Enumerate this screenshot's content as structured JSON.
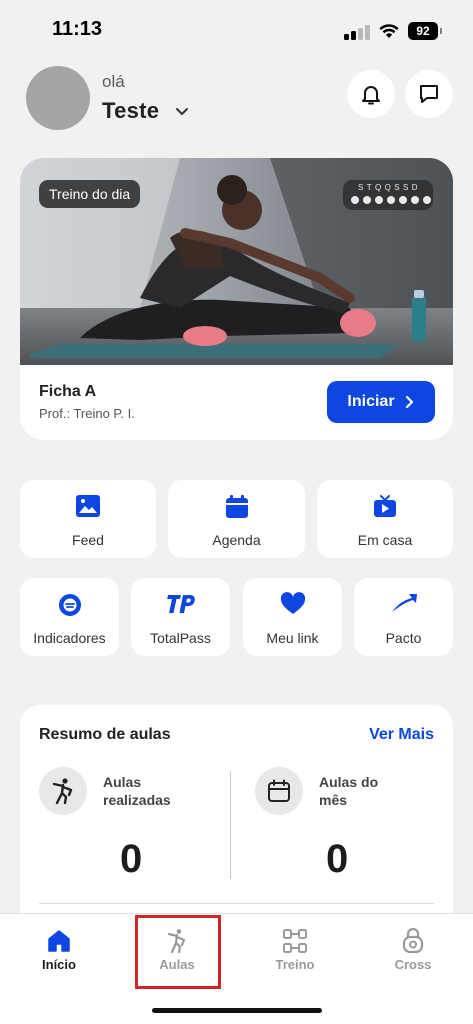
{
  "status_bar": {
    "time": "11:13",
    "battery": "92"
  },
  "header": {
    "greeting": "olá",
    "user_name": "Teste",
    "icons": [
      "bell-icon",
      "chat-icon",
      "chevron-down-icon"
    ]
  },
  "workout_card": {
    "badge": "Treino do dia",
    "week_days": "STQQSSD",
    "sheet_name": "Ficha A",
    "instructor": "Prof.: Treino P. I.",
    "start_label": "Iniciar"
  },
  "shortcuts_row1": [
    {
      "label": "Feed",
      "icon": "image-icon"
    },
    {
      "label": "Agenda",
      "icon": "calendar-icon"
    },
    {
      "label": "Em casa",
      "icon": "tv-play-icon"
    }
  ],
  "shortcuts_row2": [
    {
      "label": "Indicadores",
      "icon": "indicator-icon"
    },
    {
      "label": "TotalPass",
      "icon": "totalpass-logo"
    },
    {
      "label": "Meu link",
      "icon": "heart-icon"
    },
    {
      "label": "Pacto",
      "icon": "pacto-logo"
    }
  ],
  "summary": {
    "title": "Resumo de aulas",
    "see_more": "Ver Mais",
    "stats": [
      {
        "label": "Aulas realizadas",
        "value": "0",
        "icon": "person-stretch-icon"
      },
      {
        "label": "Aulas do mês",
        "value": "0",
        "icon": "calendar-icon"
      }
    ]
  },
  "tab_bar": {
    "tabs": [
      {
        "label": "Início",
        "icon": "home-icon",
        "active": true
      },
      {
        "label": "Aulas",
        "icon": "person-stretch-icon",
        "active": false
      },
      {
        "label": "Treino",
        "icon": "dumbbell-icon",
        "active": false
      },
      {
        "label": "Cross",
        "icon": "kettlebell-icon",
        "active": false
      }
    ]
  },
  "colors": {
    "accent": "#0d46e0",
    "background": "#f1f1f1",
    "highlight": "#d3242a"
  }
}
